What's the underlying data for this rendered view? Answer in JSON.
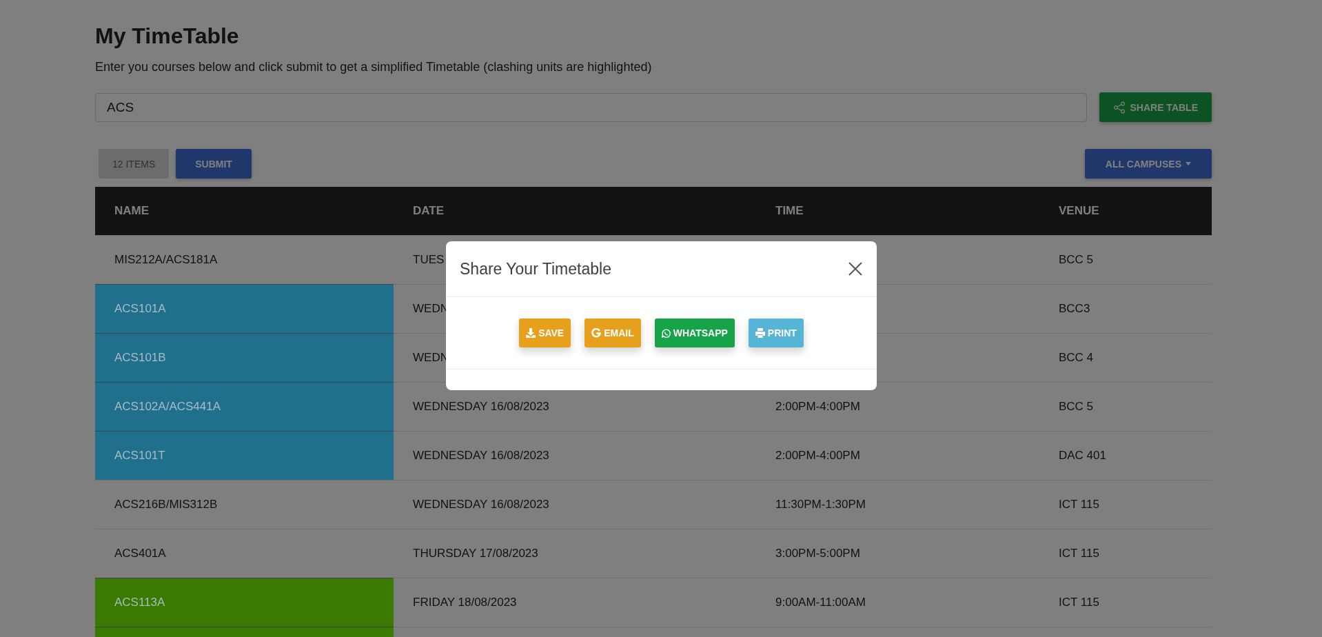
{
  "page": {
    "title": "My TimeTable",
    "subtitle": "Enter you courses below and click submit to get a simplified Timetable (clashing units are highlighted)"
  },
  "course_input": {
    "value": "ACS"
  },
  "share_button": {
    "label": "SHARE TABLE"
  },
  "items_badge": "12 ITEMS",
  "submit_button": "SUBMIT",
  "campus_dropdown": {
    "label": "ALL CAMPUSES"
  },
  "table": {
    "columns": [
      "NAME",
      "DATE",
      "TIME",
      "VENUE"
    ],
    "rows": [
      {
        "name": "MIS212A/ACS181A",
        "date": "TUES",
        "time": "",
        "venue": "BCC 5"
      },
      {
        "name": "ACS101A",
        "date": "WEDN",
        "time": "",
        "venue": "BCC3",
        "color": "#206f8c"
      },
      {
        "name": "ACS101B",
        "date": "WEDN",
        "time": "",
        "venue": "BCC 4",
        "color": "#206f8c"
      },
      {
        "name": "ACS102A/ACS441A",
        "date": "WEDNESDAY 16/08/2023",
        "time": "2:00PM-4:00PM",
        "venue": "BCC 5",
        "color": "#206f8c"
      },
      {
        "name": "ACS101T",
        "date": "WEDNESDAY 16/08/2023",
        "time": "2:00PM-4:00PM",
        "venue": "DAC 401",
        "color": "#206f8c"
      },
      {
        "name": "ACS216B/MIS312B",
        "date": "WEDNESDAY 16/08/2023",
        "time": "11:30PM-1:30PM",
        "venue": "ICT 115"
      },
      {
        "name": "ACS401A",
        "date": "THURSDAY 17/08/2023",
        "time": "3:00PM-5:00PM",
        "venue": "ICT 115"
      },
      {
        "name": "ACS113A",
        "date": "FRIDAY 18/08/2023",
        "time": "9:00AM-11:00AM",
        "venue": "ICT 115",
        "color": "#3a7a00"
      },
      {
        "name": "",
        "date": "",
        "time": "",
        "venue": "",
        "color": "#3a7a00"
      }
    ]
  },
  "modal": {
    "title": "Share Your Timetable",
    "buttons": [
      {
        "kind": "save",
        "label": "SAVE"
      },
      {
        "kind": "email",
        "label": "EMAIL"
      },
      {
        "kind": "whatsapp",
        "label": "WHATSAPP"
      },
      {
        "kind": "print",
        "label": "PRINT"
      }
    ]
  }
}
